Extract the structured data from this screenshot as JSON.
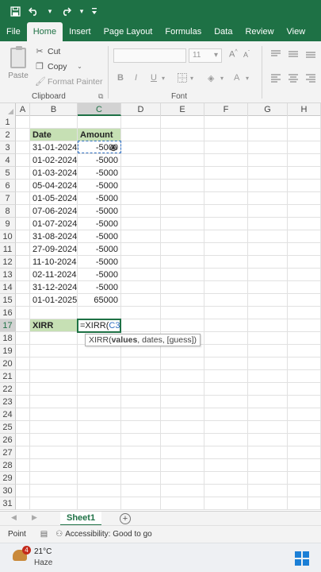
{
  "qat": {
    "save_icon": "save-icon",
    "undo_icon": "undo-icon",
    "redo_icon": "redo-icon",
    "customize_icon": "customize-qat-icon"
  },
  "tabs": [
    "File",
    "Home",
    "Insert",
    "Page Layout",
    "Formulas",
    "Data",
    "Review",
    "View"
  ],
  "active_tab": "Home",
  "ribbon": {
    "clipboard": {
      "paste_label": "Paste",
      "cut_label": "Cut",
      "copy_label": "Copy",
      "format_painter_label": "Format Painter",
      "group_label": "Clipboard"
    },
    "font": {
      "font_name": "",
      "font_size": "11",
      "group_label": "Font",
      "grow_label": "A",
      "shrink_label": "A",
      "bold": "B",
      "italic": "I",
      "underline": "U",
      "font_color": "A"
    }
  },
  "columns": [
    "A",
    "B",
    "C",
    "D",
    "E",
    "F",
    "G",
    "H"
  ],
  "rows": [
    {
      "n": "1",
      "b": "",
      "c": ""
    },
    {
      "n": "2",
      "b": "Date",
      "c": "Amount"
    },
    {
      "n": "3",
      "b": "31-01-2024",
      "c": "-5000"
    },
    {
      "n": "4",
      "b": "01-02-2024",
      "c": "-5000"
    },
    {
      "n": "5",
      "b": "01-03-2024",
      "c": "-5000"
    },
    {
      "n": "6",
      "b": "05-04-2024",
      "c": "-5000"
    },
    {
      "n": "7",
      "b": "01-05-2024",
      "c": "-5000"
    },
    {
      "n": "8",
      "b": "07-06-2024",
      "c": "-5000"
    },
    {
      "n": "9",
      "b": "01-07-2024",
      "c": "-5000"
    },
    {
      "n": "10",
      "b": "31-08-2024",
      "c": "-5000"
    },
    {
      "n": "11",
      "b": "27-09-2024",
      "c": "-5000"
    },
    {
      "n": "12",
      "b": "11-10-2024",
      "c": "-5000"
    },
    {
      "n": "13",
      "b": "02-11-2024",
      "c": "-5000"
    },
    {
      "n": "14",
      "b": "31-12-2024",
      "c": "-5000"
    },
    {
      "n": "15",
      "b": "01-01-2025",
      "c": "65000"
    },
    {
      "n": "16",
      "b": "",
      "c": ""
    },
    {
      "n": "17",
      "b": "XIRR",
      "c": ""
    },
    {
      "n": "18",
      "b": "",
      "c": ""
    },
    {
      "n": "19",
      "b": "",
      "c": ""
    },
    {
      "n": "20",
      "b": "",
      "c": ""
    },
    {
      "n": "21",
      "b": "",
      "c": ""
    },
    {
      "n": "22",
      "b": "",
      "c": ""
    },
    {
      "n": "23",
      "b": "",
      "c": ""
    },
    {
      "n": "24",
      "b": "",
      "c": ""
    },
    {
      "n": "25",
      "b": "",
      "c": ""
    },
    {
      "n": "26",
      "b": "",
      "c": ""
    },
    {
      "n": "27",
      "b": "",
      "c": ""
    },
    {
      "n": "28",
      "b": "",
      "c": ""
    },
    {
      "n": "29",
      "b": "",
      "c": ""
    },
    {
      "n": "30",
      "b": "",
      "c": ""
    },
    {
      "n": "31",
      "b": "",
      "c": ""
    }
  ],
  "active_cell": {
    "formula_prefix": "=XIRR(",
    "reference": "C3"
  },
  "tooltip": {
    "func": "XIRR(",
    "arg_current": "values",
    "rest": ", dates, [guess])"
  },
  "sheets": [
    "Sheet1"
  ],
  "status": {
    "mode": "Point",
    "accessibility": "Accessibility: Good to go"
  },
  "taskbar": {
    "weather_badge": "4",
    "temperature": "21°C",
    "condition": "Haze"
  },
  "colors": {
    "excel_green": "#1e7145",
    "table_header_fill": "#c6e0b4",
    "reference_blue": "#2f6fc1"
  }
}
